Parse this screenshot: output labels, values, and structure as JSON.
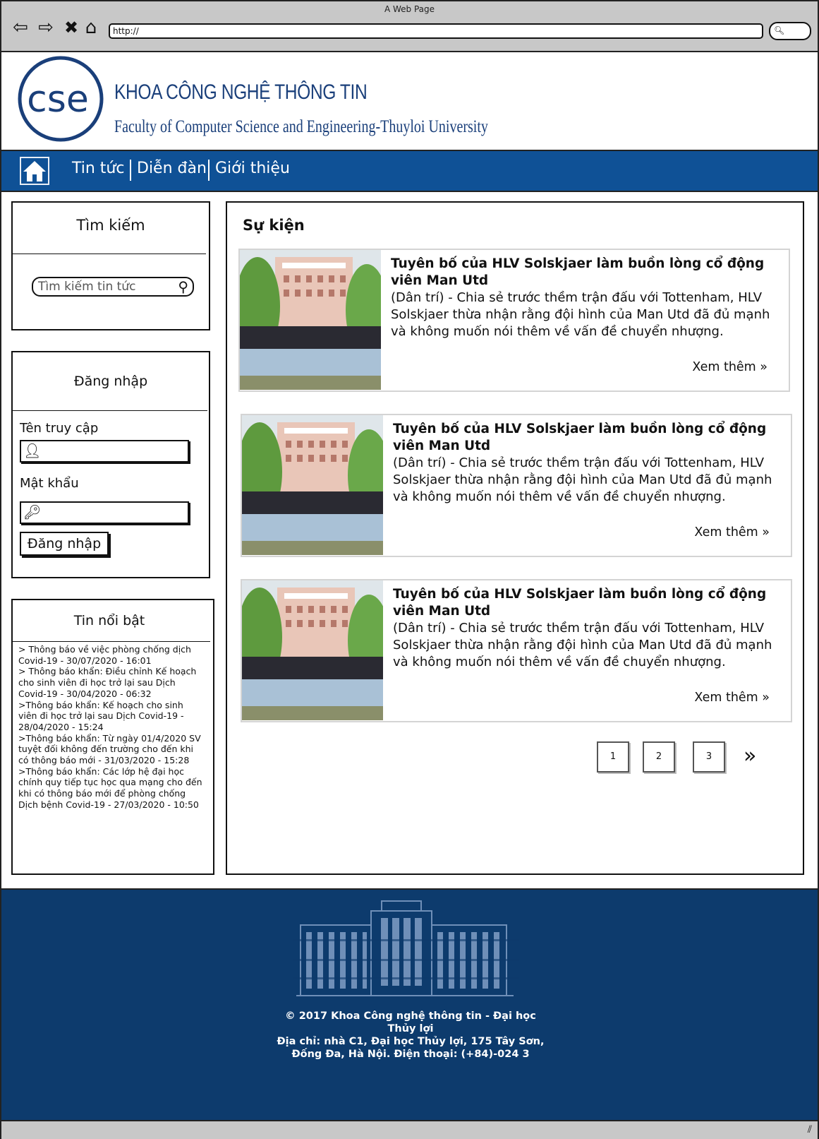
{
  "browser": {
    "window_title": "A Web Page",
    "url": "http://",
    "icons": [
      "back-icon",
      "forward-icon",
      "close-icon",
      "home-icon",
      "search-icon"
    ]
  },
  "header": {
    "logo_text": "cse",
    "title": "KHOA CÔNG NGHỆ THÔNG TIN",
    "subtitle": "Faculty of Computer Science and Engineering-Thuyloi University"
  },
  "nav": {
    "items": [
      "Tin tức",
      "Diễn đàn",
      "Giới thiệu"
    ],
    "colors": {
      "background": "#0f5196",
      "text": "#ffffff"
    }
  },
  "search": {
    "title": "Tìm kiếm",
    "placeholder": "Tìm kiếm tin tức"
  },
  "login": {
    "title": "Đăng nhập",
    "username_label": "Tên truy cập",
    "password_label": "Mật khẩu",
    "button_label": "Đăng nhập"
  },
  "featured": {
    "title": "Tin nổi bật",
    "items": [
      "> Thông báo về việc phòng chống dịch Covid-19 - 30/07/2020 - 16:01",
      "> Thông báo khẩn: Điều chỉnh Kế hoạch cho sinh viên đi học trở lại sau Dịch Covid-19 - 30/04/2020 - 06:32",
      ">Thông báo khẩn: Kế hoạch cho sinh viên đi học trở lại sau Dịch Covid-19 - 28/04/2020 - 15:24",
      ">Thông báo khẩn: Từ ngày 01/4/2020 SV tuyệt đối không đến trường cho đến khi có thông báo mới - 31/03/2020 -   15:28",
      " >Thông báo khẩn: Các lớp hệ đại học chính quy tiếp tục học qua mạng cho đến khi có thông báo mới để phòng chống Dịch bệnh Covid-19 - 27/03/2020 - 10:50"
    ]
  },
  "events": {
    "title": "Sự kiện",
    "cards": [
      {
        "title": "Tuyên bố của HLV Solskjaer làm buồn lòng cổ động viên Man Utd",
        "text": "(Dân trí) - Chia sẻ trước thềm trận đấu với Tottenham, HLV Solskjaer thừa nhận rằng đội hình của Man Utd đã đủ mạnh và không muốn nói thêm về vấn đề chuyển nhượng.",
        "more": "Xem thêm »"
      },
      {
        "title": "Tuyên bố của HLV Solskjaer làm buồn lòng cổ động viên Man Utd",
        "text": "(Dân trí) - Chia sẻ trước thềm trận đấu với Tottenham, HLV Solskjaer thừa nhận rằng đội hình của Man Utd đã đủ mạnh và không muốn nói thêm về vấn đề chuyển nhượng.",
        "more": "Xem thêm »"
      },
      {
        "title": "Tuyên bố của HLV Solskjaer làm buồn lòng cổ động viên Man Utd",
        "text": "(Dân trí) - Chia sẻ trước thềm trận đấu với Tottenham, HLV Solskjaer thừa nhận rằng đội hình của Man Utd đã đủ mạnh và không muốn nói thêm về vấn đề chuyển nhượng.",
        "more": "Xem thêm »"
      }
    ]
  },
  "pagination": {
    "pages": [
      "1",
      "2",
      "3"
    ],
    "next": "»"
  },
  "footer": {
    "copyright": "© 2017 Khoa Công nghệ thông tin - Đại học Thủy lợi",
    "address": "Địa chỉ: nhà C1, Đại học Thủy lợi, 175 Tây Sơn, Đống Đa, Hà Nội. Điện thoại: (+84)-024 3",
    "colors": {
      "background": "#0d3b6d"
    }
  }
}
